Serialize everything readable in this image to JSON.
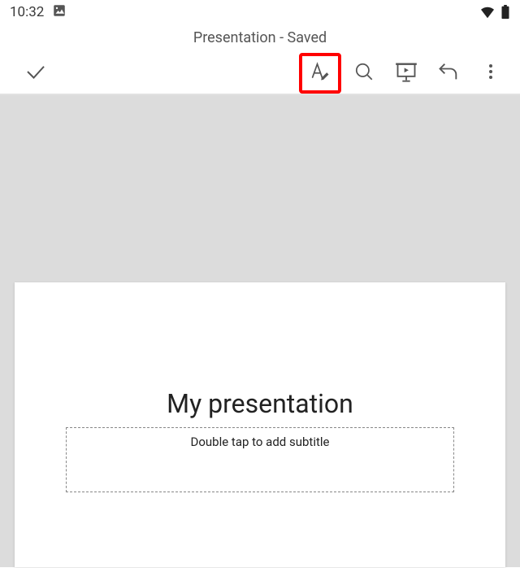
{
  "status": {
    "time": "10:32",
    "gallery_icon": "image-icon",
    "wifi_icon": "wifi-icon",
    "battery_icon": "battery-icon"
  },
  "header": {
    "title": "Presentation - Saved"
  },
  "toolbar": {
    "done_icon": "check-icon",
    "edit_icon": "text-edit-icon",
    "search_icon": "search-icon",
    "present_icon": "present-icon",
    "undo_icon": "undo-icon",
    "more_icon": "more-vertical-icon"
  },
  "slide": {
    "title": "My presentation",
    "subtitle_placeholder": "Double tap to add subtitle"
  }
}
